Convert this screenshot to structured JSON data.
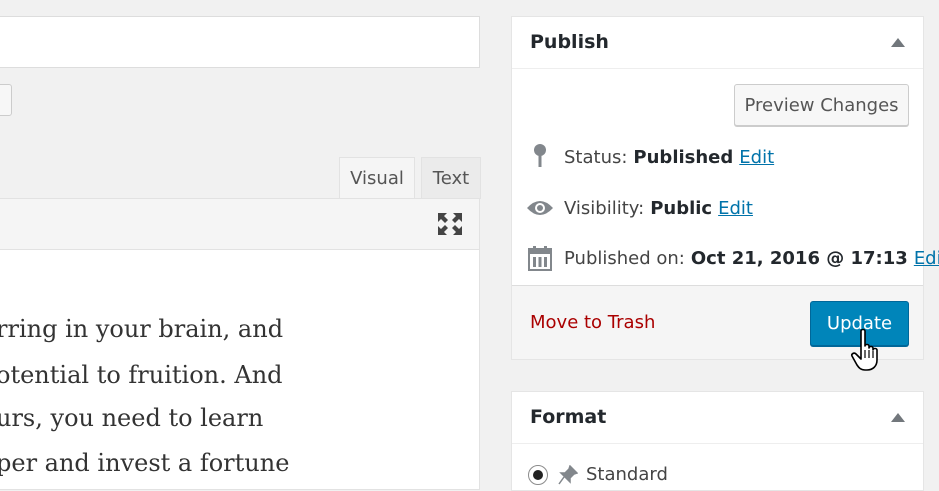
{
  "editor": {
    "tabs": {
      "visual": "Visual",
      "text": "Text"
    },
    "lines": [
      "rring in your brain, and",
      "otential to fruition. And",
      "urs, you need to learn",
      "per and invest a fortune"
    ]
  },
  "publish": {
    "title": "Publish",
    "preview_button": "Preview Changes",
    "status": {
      "label": "Status:",
      "value": "Published",
      "edit": "Edit"
    },
    "visibility": {
      "label": "Visibility:",
      "value": "Public",
      "edit": "Edit"
    },
    "published_on": {
      "label": "Published on:",
      "value": "Oct 21, 2016 @ 17:13",
      "edit": "Edit"
    },
    "trash_link": "Move to Trash",
    "update_button": "Update"
  },
  "format": {
    "title": "Format",
    "option_label": "Standard"
  },
  "colors": {
    "primary_button": "#0085ba",
    "link": "#0073aa",
    "trash": "#aa0000"
  },
  "icons": [
    "pin-icon",
    "eye-icon",
    "calendar-icon",
    "fullscreen-icon",
    "pointer-cursor-icon",
    "thumbtack-icon"
  ]
}
